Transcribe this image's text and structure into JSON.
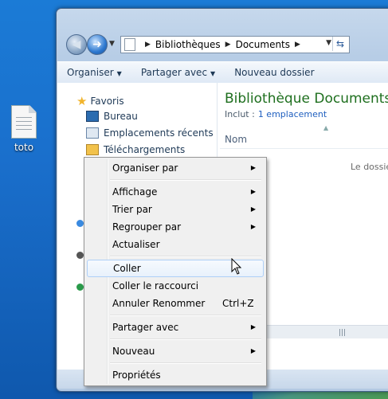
{
  "desktop": {
    "icon_label": "toto"
  },
  "window": {
    "breadcrumb": [
      "Bibliothèques",
      "Documents"
    ],
    "toolbar": {
      "organize": "Organiser",
      "share": "Partager avec",
      "new_folder": "Nouveau dossier"
    },
    "nav": {
      "favorites": "Favoris",
      "items": [
        "Bureau",
        "Emplacements récents",
        "Téléchargements"
      ]
    },
    "library": {
      "title": "Bibliothèque Documents",
      "include_label": "Inclut :",
      "include_link": "1 emplacement",
      "column": "Nom",
      "empty_message": "Le dossier"
    }
  },
  "context_menu": {
    "organize_by": "Organiser par",
    "view": "Affichage",
    "sort_by": "Trier par",
    "group_by": "Regrouper par",
    "refresh": "Actualiser",
    "paste": "Coller",
    "paste_shortcut": "Coller le raccourci",
    "undo_rename": "Annuler Renommer",
    "undo_shortcut": "Ctrl+Z",
    "share_with": "Partager avec",
    "new": "Nouveau",
    "properties": "Propriétés"
  }
}
